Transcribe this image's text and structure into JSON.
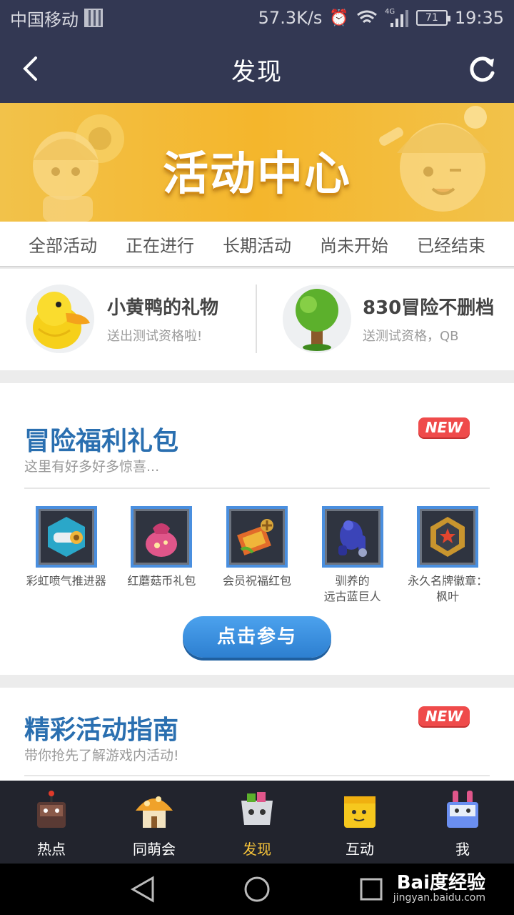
{
  "status_bar": {
    "carrier": "中国移动",
    "speed": "57.3K/s",
    "network": "4G",
    "battery": "71",
    "time": "19:35"
  },
  "header": {
    "title": "发现"
  },
  "banner": {
    "title": "活动中心"
  },
  "tabs": [
    {
      "label": "全部活动"
    },
    {
      "label": "正在进行"
    },
    {
      "label": "长期活动"
    },
    {
      "label": "尚未开始"
    },
    {
      "label": "已经结束"
    }
  ],
  "featured": [
    {
      "title": "小黄鸭的礼物",
      "subtitle": "送出测试资格啦!"
    },
    {
      "title": "830冒险不删档",
      "subtitle": "送测试资格，QB"
    }
  ],
  "card_gift": {
    "title": "冒险福利礼包",
    "subtitle": "这里有好多好多惊喜...",
    "badge": "NEW",
    "rewards": [
      {
        "name": "彩虹喷气推进器"
      },
      {
        "name": "红蘑菇币礼包"
      },
      {
        "name": "会员祝福红包"
      },
      {
        "name": "驯养的\n远古蓝巨人"
      },
      {
        "name": "永久名牌徽章：\n枫叶"
      }
    ],
    "button": "点击参与"
  },
  "card_guide": {
    "title": "精彩活动指南",
    "subtitle": "带你抢先了解游戏内活动!",
    "badge": "NEW"
  },
  "bottom_nav": [
    {
      "label": "热点"
    },
    {
      "label": "同萌会"
    },
    {
      "label": "发现"
    },
    {
      "label": "互动"
    },
    {
      "label": "我"
    }
  ],
  "watermark": {
    "brand": "Bai度经验",
    "url": "jingyan.baidu.com"
  },
  "colors": {
    "header_bg": "#333853",
    "accent_blue": "#2a6fb0",
    "active_nav": "#f7c43a",
    "badge_red": "#ef4b4b"
  }
}
